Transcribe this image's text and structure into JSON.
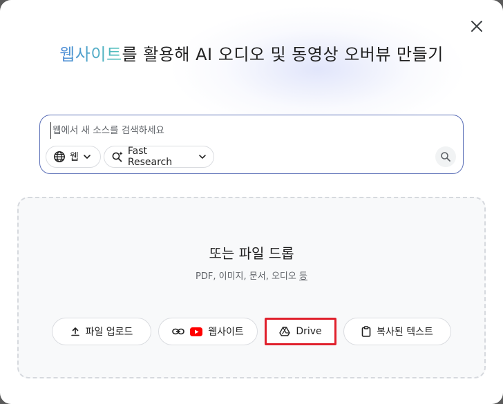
{
  "dialog": {
    "title_highlight": "웹사이트",
    "title_rest": "를 활용해 AI 오디오 및 동영상 오버뷰 만들기",
    "close_label": "×"
  },
  "search": {
    "placeholder": "웹에서 새 소스를 검색하세요",
    "source_chip_label": "웹",
    "mode_chip_label": "Fast Research"
  },
  "drop_zone": {
    "title": "또는 파일 드롭",
    "subtitle_main": "PDF, 이미지, 문서, 오디오 ",
    "subtitle_last": "등"
  },
  "buttons": {
    "upload": "파일 업로드",
    "website": "웹사이트",
    "drive": "Drive",
    "paste": "복사된 텍스트"
  },
  "colors": {
    "accent_border": "#5b6fb7",
    "highlight_box": "#e0202c",
    "youtube_red": "#ff0000"
  }
}
